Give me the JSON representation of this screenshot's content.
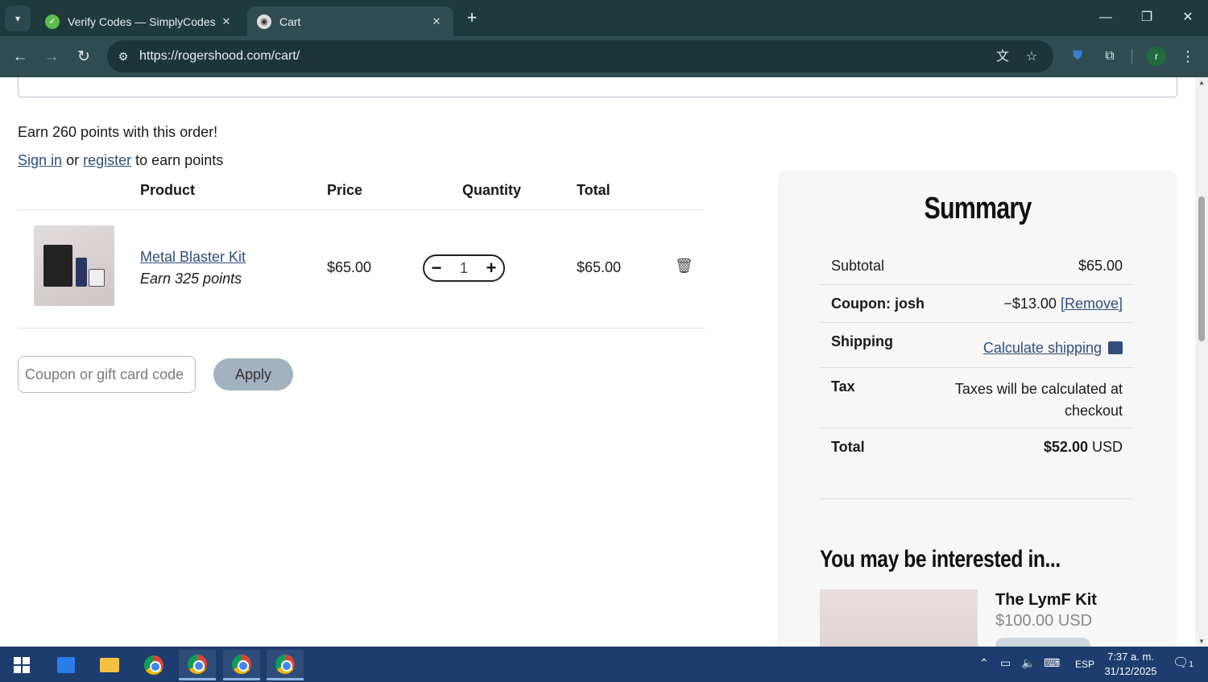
{
  "browser": {
    "tabs": [
      {
        "title": "Verify Codes — SimplyCodes",
        "active": false
      },
      {
        "title": "Cart",
        "active": true
      }
    ],
    "url": "https://rogershood.com/cart/",
    "profile_initial": "r"
  },
  "cart": {
    "earn_points": "Earn 260 points with this order!",
    "sign_in": "Sign in",
    "or": "or",
    "register": "register",
    "earn_suffix": "to earn points",
    "headers": {
      "product": "Product",
      "price": "Price",
      "quantity": "Quantity",
      "total": "Total"
    },
    "items": [
      {
        "name": "Metal Blaster Kit",
        "points": "Earn 325 points",
        "price": "$65.00",
        "quantity": "1",
        "total": "$65.00"
      }
    ],
    "coupon_placeholder": "Coupon or gift card code",
    "apply_label": "Apply"
  },
  "summary": {
    "title": "Summary",
    "subtotal_label": "Subtotal",
    "subtotal_value": "$65.00",
    "coupon_label": "Coupon: josh",
    "coupon_value": "−$13.00",
    "coupon_remove": "[Remove]",
    "shipping_label": "Shipping",
    "shipping_value": "Calculate shipping",
    "tax_label": "Tax",
    "tax_value": "Taxes will be calculated at checkout",
    "total_label": "Total",
    "total_value": "$52.00",
    "total_currency": "USD"
  },
  "recommendations": {
    "heading": "You may be interested in...",
    "items": [
      {
        "name": "The LymF Kit",
        "price": "$100.00 USD"
      }
    ]
  },
  "taskbar": {
    "language": "ESP",
    "time": "7:37 a. m.",
    "date": "31/12/2025",
    "notifications": "1"
  },
  "colors": {
    "chrome_dark": "#1f3a3d",
    "chrome_toolbar": "#2f4d51",
    "link": "#2f4e7a",
    "apply_button": "#a3b2bf",
    "summary_bg": "#f7f7f7",
    "taskbar": "#1c3d6e"
  },
  "icons": [
    "tab-search-icon",
    "simplycodes-favicon",
    "cart-favicon",
    "close-icon",
    "new-tab-icon",
    "minimize-icon",
    "restore-icon",
    "window-close-icon",
    "back-icon",
    "forward-icon",
    "reload-icon",
    "site-info-icon",
    "translate-icon",
    "bookmark-star-icon",
    "shield-extension-icon",
    "extensions-puzzle-icon",
    "menu-kebab-icon",
    "trash-icon",
    "shipping-calculator-icon",
    "windows-start-icon",
    "store-icon",
    "file-explorer-icon",
    "chrome-icon"
  ]
}
